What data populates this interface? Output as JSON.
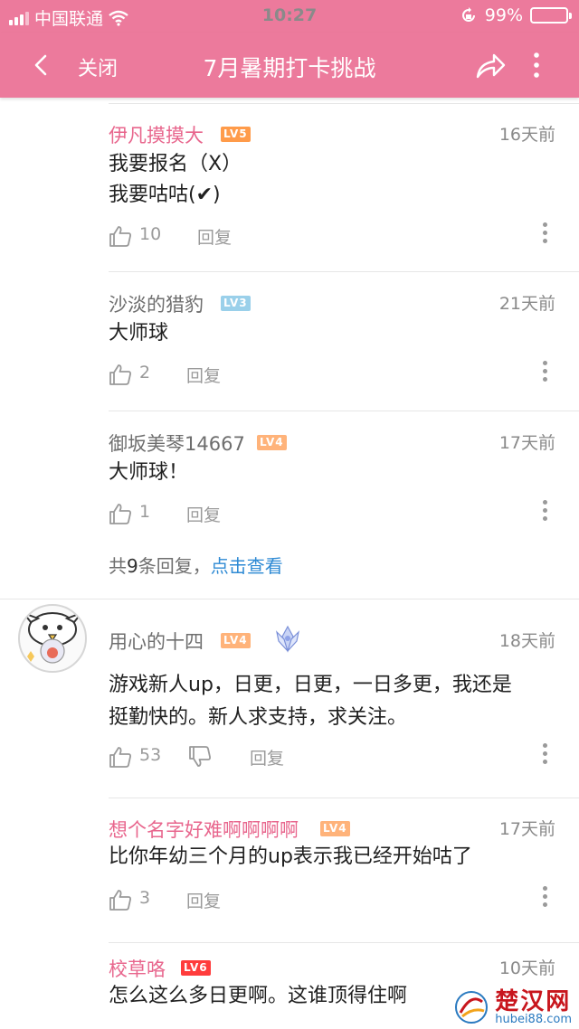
{
  "status_bar": {
    "carrier": "中国联通",
    "time": "10:27",
    "battery": "99%",
    "battery_level": 0.99
  },
  "nav": {
    "close_label": "关闭",
    "title": "7月暑期打卡挑战"
  },
  "replies": [
    {
      "username": "伊凡摸摸大",
      "level": "LV5",
      "time": "16天前",
      "line1": "我要报名（X）",
      "line2": "我要咕咕(✔)",
      "likes": "10",
      "reply_label": "回复"
    },
    {
      "username": "沙淡的猎豹",
      "level": "LV3",
      "time": "21天前",
      "line1": "大师球",
      "likes": "2",
      "reply_label": "回复"
    },
    {
      "username": "御坂美琴14667",
      "level": "LV4",
      "time": "17天前",
      "line1": "大师球！",
      "likes": "1",
      "reply_label": "回复"
    }
  ],
  "reply_count": {
    "prefix": "共",
    "count": "9",
    "suffix": "条回复，",
    "link": "点击查看"
  },
  "comment": {
    "username": "用心的十四",
    "level": "LV4",
    "time": "18天前",
    "line1": "游戏新人up，日更，日更，一日多更，我还是",
    "line2": "挺勤快的。新人求支持，求关注。",
    "likes": "53",
    "reply_label": "回复"
  },
  "comment_replies": [
    {
      "username": "想个名字好难啊啊啊啊",
      "level": "LV4",
      "time": "17天前",
      "line1": "比你年幼三个月的up表示我已经开始咕了",
      "likes": "3",
      "reply_label": "回复"
    },
    {
      "username": "校草咯",
      "level": "LV6",
      "time": "10天前",
      "line1": "怎么这么多日更啊。这谁顶得住啊"
    }
  ],
  "watermark": {
    "name": "楚汉网",
    "url": "hubei88.com"
  },
  "icons": {
    "back": "chevron-left-icon",
    "share": "share-icon",
    "more": "more-vertical-icon",
    "like": "thumbs-up-icon",
    "dislike": "thumbs-down-icon",
    "wifi": "wifi-icon",
    "signal": "signal-icon",
    "lock": "rotation-lock-icon",
    "badge": "crystal-badge-icon"
  },
  "colors": {
    "accent": "#ec7a9c",
    "vip_name": "#e8668d",
    "link": "#2e8ad4",
    "battery": "#58d35a"
  }
}
